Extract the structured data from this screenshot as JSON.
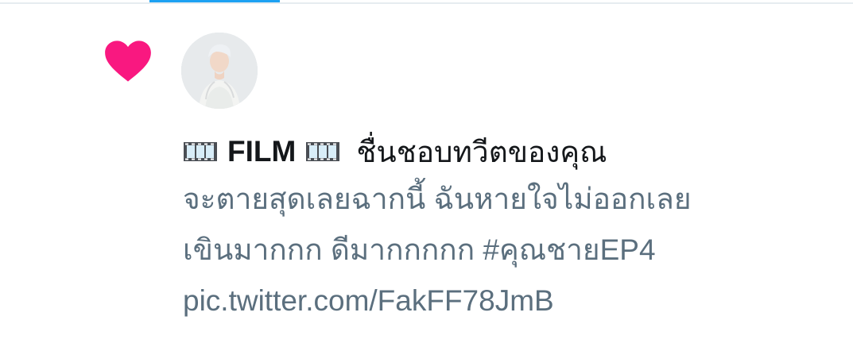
{
  "notification": {
    "user_name": "FILM",
    "action_text": "ชื่นชอบทวีตของคุณ",
    "avatar_alt": "avatar",
    "like_color": "#f91880",
    "tweet_lines": [
      "จะตายสุดเลยฉากนี้  ฉันหายใจไม่ออกเลย",
      "เขินมากกก  ดีมากกกกก   #คุณชายEP4",
      "pic.twitter.com/FakFF78JmB"
    ],
    "icons": {
      "like": "heart-icon",
      "film": "film-frames-icon"
    }
  }
}
